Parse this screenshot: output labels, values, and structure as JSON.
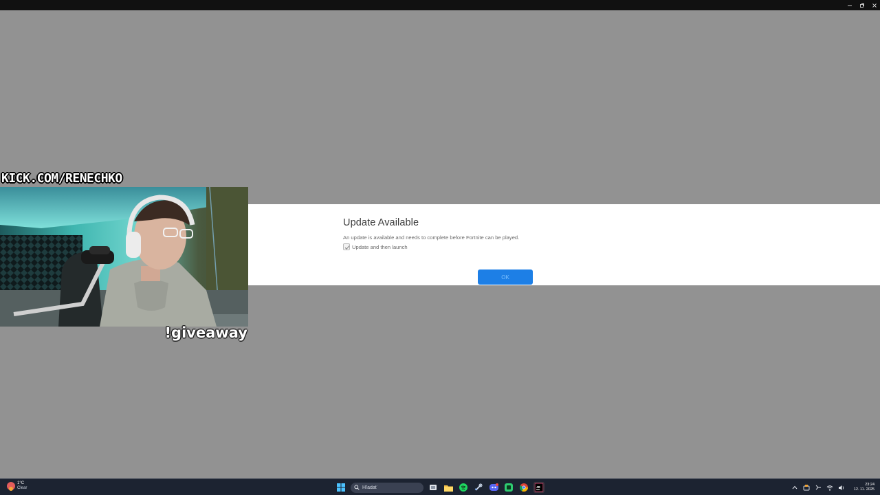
{
  "window": {
    "controls": [
      "minimize",
      "restore",
      "close"
    ]
  },
  "dialog": {
    "title": "Update Available",
    "message": "An update is available and needs to complete before Fortnite can be played.",
    "checkbox_label": "Update and then launch",
    "checkbox_checked": true,
    "ok_label": "OK",
    "accent": "#1d7fe6"
  },
  "stream_overlay": {
    "channel_url": "KICK.COM/RENECHKO",
    "command": "!giveaway"
  },
  "taskbar": {
    "weather": {
      "temp": "1°C",
      "condition": "Clear"
    },
    "search_placeholder": "Hľadať",
    "apps": [
      "windows-start",
      "task-view",
      "file-explorer",
      "spotify",
      "steam",
      "discord",
      "app-green",
      "chrome",
      "jetbrains"
    ],
    "clock": {
      "time": "23:24",
      "date": "12. 11. 2025"
    }
  }
}
